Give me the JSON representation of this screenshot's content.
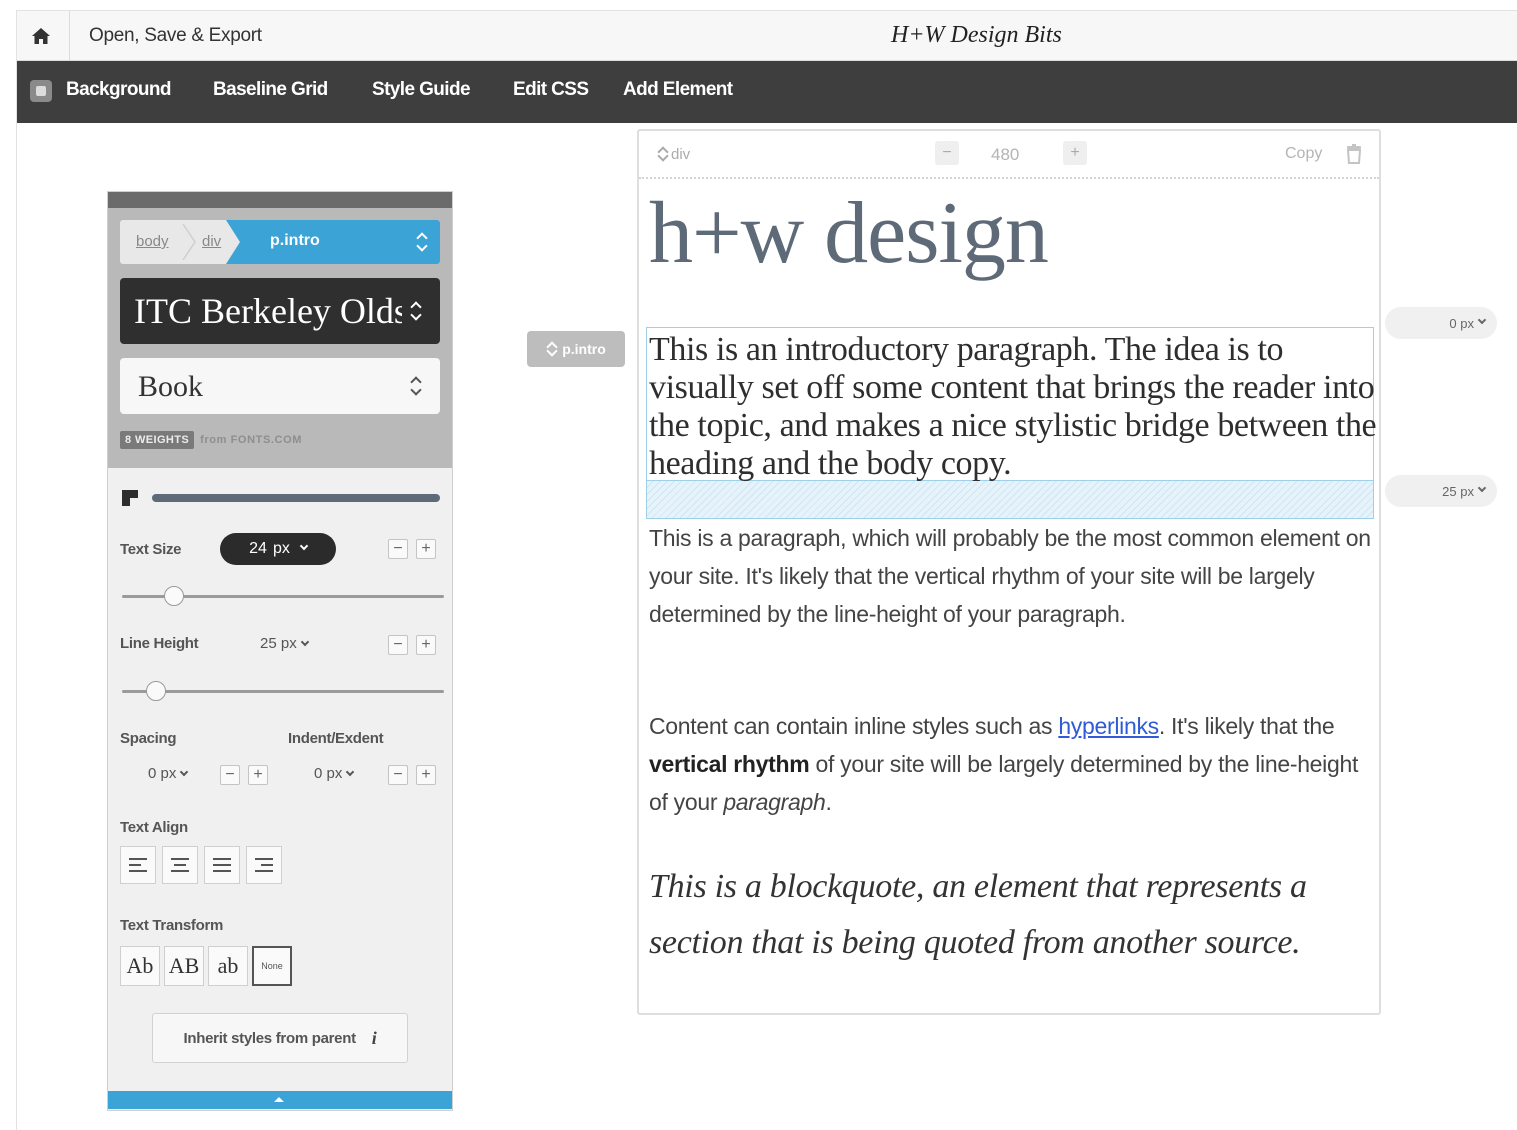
{
  "app": {
    "open_save_export": "Open, Save & Export",
    "title": "H+W Design Bits"
  },
  "toolbar": {
    "items": [
      "Background",
      "Baseline Grid",
      "Style Guide",
      "Edit CSS",
      "Add Element"
    ]
  },
  "panel": {
    "breadcrumb": [
      "body",
      "div"
    ],
    "active_selector": "p.intro",
    "font_family": "ITC Berkeley Oldstyle",
    "font_weight": "Book",
    "weights_badge": "8 WEIGHTS",
    "weights_source": "from FONTS.COM",
    "text_size_label": "Text Size",
    "text_size_value": "24",
    "text_size_unit": "px",
    "line_height_label": "Line Height",
    "line_height_value": "25",
    "line_height_unit": "px",
    "spacing_label": "Spacing",
    "spacing_value": "0",
    "spacing_unit": "px",
    "indent_label": "Indent/Exdent",
    "indent_value": "0",
    "indent_unit": "px",
    "text_align_label": "Text Align",
    "text_transform_label": "Text Transform",
    "text_transform_options": [
      "Ab",
      "AB",
      "ab",
      "None"
    ],
    "inherit_button": "Inherit styles from parent",
    "minus": "−",
    "plus": "+"
  },
  "canvas": {
    "selector_tag": "p.intro",
    "element": "div",
    "width": "480",
    "minus": "−",
    "plus": "+",
    "copy": "Copy",
    "heading": "h+w design",
    "intro": "This is an introductory paragraph. The idea is to visually set off some content that brings the reader into the topic, and makes a nice stylistic bridge between the heading and the body copy.",
    "paragraph1": "This is a paragraph, which will probably be the most common element on your site. It's likely that the vertical rhythm of your site will be largely determined by the line-height of your paragraph.",
    "paragraph2_before_link": "Content can contain inline styles such as ",
    "paragraph2_link": "hyperlinks",
    "paragraph2_mid": ". It's likely that the ",
    "paragraph2_bold": "vertical rhythm",
    "paragraph2_after_bold": " of your site will be largely determined by the line-height of your ",
    "paragraph2_italic": "paragraph",
    "paragraph2_end": ".",
    "blockquote": "This is a blockquote, an element that represents a section that is being quoted from another source.",
    "margin_top_value": "0",
    "margin_top_unit": "px",
    "margin_bottom_value": "25",
    "margin_bottom_unit": "px"
  },
  "colors": {
    "toolbar_bg": "#3e3e3e",
    "accent_blue": "#3ba3d6",
    "heading_color": "#5e6a78",
    "link_color": "#2f5bd9"
  }
}
